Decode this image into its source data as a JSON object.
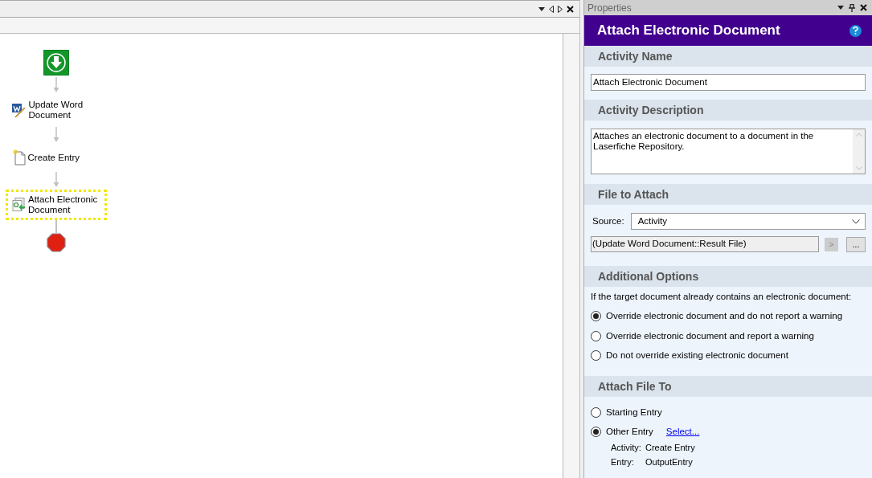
{
  "workflow": {
    "nodes": [
      {
        "kind": "start"
      },
      {
        "kind": "activity",
        "label": "Update Word Document",
        "selected": false
      },
      {
        "kind": "activity",
        "label": "Create Entry",
        "selected": false
      },
      {
        "kind": "activity",
        "label": "Attach Electronic Document",
        "selected": true
      },
      {
        "kind": "end"
      }
    ]
  },
  "properties": {
    "pane_title": "Properties",
    "title": "Attach Electronic Document",
    "activity_name": {
      "heading": "Activity Name",
      "value": "Attach Electronic Document"
    },
    "activity_description": {
      "heading": "Activity Description",
      "value": "Attaches an electronic document to a document in the Laserfiche Repository."
    },
    "file_to_attach": {
      "heading": "File to Attach",
      "source_label": "Source:",
      "source_value": "Activity",
      "file_value": "(Update Word Document::Result File)",
      "insert_button": ">",
      "browse_button": "..."
    },
    "additional_options": {
      "heading": "Additional Options",
      "prompt": "If the target document already contains an electronic document:",
      "options": [
        {
          "label": "Override electronic document and do not report a warning",
          "selected": true
        },
        {
          "label": "Override electronic document and report a warning",
          "selected": false
        },
        {
          "label": "Do not override existing electronic document",
          "selected": false
        }
      ]
    },
    "attach_file_to": {
      "heading": "Attach File To",
      "options": [
        {
          "label": "Starting Entry",
          "selected": false
        },
        {
          "label": "Other Entry",
          "selected": true,
          "link": "Select...",
          "details": [
            {
              "label": "Activity:",
              "value": "Create Entry"
            },
            {
              "label": "Entry:",
              "value": "OutputEntry"
            }
          ]
        }
      ]
    }
  }
}
